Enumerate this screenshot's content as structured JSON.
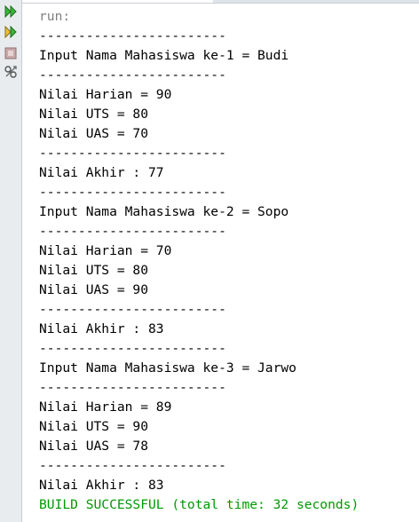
{
  "gutter": {
    "buttons": [
      {
        "icon": "rerun-icon"
      },
      {
        "icon": "rerun-with-input-icon"
      },
      {
        "icon": "stop-icon"
      },
      {
        "icon": "output-settings-icon"
      }
    ]
  },
  "output": {
    "lines": [
      {
        "text": "run:",
        "color": "gray"
      },
      {
        "text": "------------------------",
        "color": "default"
      },
      {
        "text": "Input Nama Mahasiswa ke-1 = Budi",
        "color": "default"
      },
      {
        "text": "------------------------",
        "color": "default"
      },
      {
        "text": "Nilai Harian = 90",
        "color": "default"
      },
      {
        "text": "Nilai UTS = 80",
        "color": "default"
      },
      {
        "text": "Nilai UAS = 70",
        "color": "default"
      },
      {
        "text": "------------------------",
        "color": "default"
      },
      {
        "text": "Nilai Akhir : 77",
        "color": "default"
      },
      {
        "text": "------------------------",
        "color": "default"
      },
      {
        "text": "Input Nama Mahasiswa ke-2 = Sopo",
        "color": "default"
      },
      {
        "text": "------------------------",
        "color": "default"
      },
      {
        "text": "Nilai Harian = 70",
        "color": "default"
      },
      {
        "text": "Nilai UTS = 80",
        "color": "default"
      },
      {
        "text": "Nilai UAS = 90",
        "color": "default"
      },
      {
        "text": "------------------------",
        "color": "default"
      },
      {
        "text": "Nilai Akhir : 83",
        "color": "default"
      },
      {
        "text": "------------------------",
        "color": "default"
      },
      {
        "text": "Input Nama Mahasiswa ke-3 = Jarwo",
        "color": "default"
      },
      {
        "text": "------------------------",
        "color": "default"
      },
      {
        "text": "Nilai Harian = 89",
        "color": "default"
      },
      {
        "text": "Nilai UTS = 90",
        "color": "default"
      },
      {
        "text": "Nilai UAS = 78",
        "color": "default"
      },
      {
        "text": "------------------------",
        "color": "default"
      },
      {
        "text": "Nilai Akhir : 83",
        "color": "default"
      },
      {
        "text": "BUILD SUCCESSFUL (total time: 32 seconds)",
        "color": "green"
      }
    ]
  },
  "colors": {
    "run_label": "#808080",
    "build_success": "#009900",
    "rerun_icon": "#2e9a2e"
  }
}
